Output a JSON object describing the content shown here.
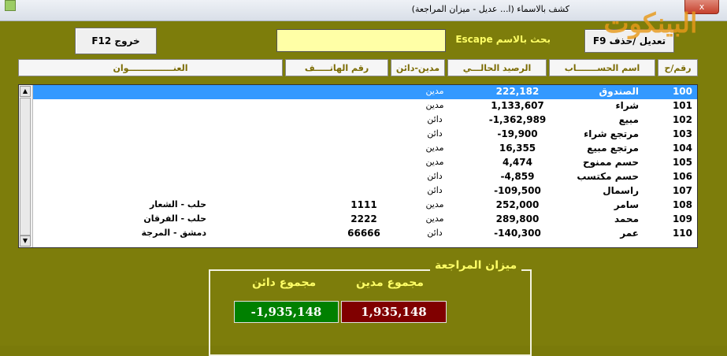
{
  "window": {
    "title": "كشف بالاسماء (ا... عديل - ميزان المراجعة)",
    "close": "x",
    "watermark": "البينكوت"
  },
  "toolbar": {
    "exit_label": "خروج  F12",
    "edit_label": "تعديل /حذف  F9",
    "search_label": "بحث بالاسم Escape",
    "search_value": ""
  },
  "columns": {
    "code": "رقم/ح",
    "name": "اسم الحســـــــاب",
    "balance": "الرصيد الحالـــي",
    "type": "مدين-دائن",
    "phone": "رقم الهاتـــــف",
    "address": "العنـــــــــــــــوان"
  },
  "rows": [
    {
      "code": "100",
      "name": "الصندوق",
      "balance": "222,182",
      "type": "مدين",
      "phone": "",
      "address": ""
    },
    {
      "code": "101",
      "name": "شراء",
      "balance": "1,133,607",
      "type": "مدين",
      "phone": "",
      "address": ""
    },
    {
      "code": "102",
      "name": "مبيع",
      "balance": "-1,362,989",
      "type": "دائن",
      "phone": "",
      "address": ""
    },
    {
      "code": "103",
      "name": "مرتجع شراء",
      "balance": "-19,900",
      "type": "دائن",
      "phone": "",
      "address": ""
    },
    {
      "code": "104",
      "name": "مرتجع مبيع",
      "balance": "16,355",
      "type": "مدين",
      "phone": "",
      "address": ""
    },
    {
      "code": "105",
      "name": "حسم ممنوح",
      "balance": "4,474",
      "type": "مدين",
      "phone": "",
      "address": ""
    },
    {
      "code": "106",
      "name": "حسم مكتسب",
      "balance": "-4,859",
      "type": "دائن",
      "phone": "",
      "address": ""
    },
    {
      "code": "107",
      "name": "راسمال",
      "balance": "-109,500",
      "type": "دائن",
      "phone": "",
      "address": ""
    },
    {
      "code": "108",
      "name": "سامر",
      "balance": "252,000",
      "type": "مدين",
      "phone": "1111",
      "address": "حلب - الشعار"
    },
    {
      "code": "109",
      "name": "محمد",
      "balance": "289,800",
      "type": "مدين",
      "phone": "2222",
      "address": "حلب - الفرقان"
    },
    {
      "code": "110",
      "name": "عمر",
      "balance": "-140,300",
      "type": "دائن",
      "phone": "66666",
      "address": "دمشق - المرجة"
    }
  ],
  "summary": {
    "title": "ميزان المراجعة",
    "debit_label": "مجموع مدين",
    "credit_label": "مجموع دائن",
    "debit_total": "1,935,148",
    "credit_total": "-1,935,148",
    "debit_color": "#800000",
    "credit_color": "#008000"
  }
}
